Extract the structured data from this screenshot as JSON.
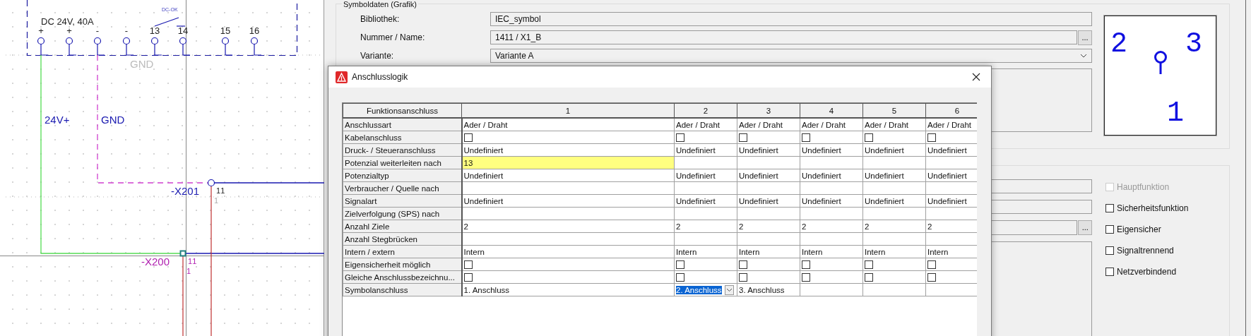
{
  "schematic": {
    "contact_label": "DC-OK",
    "device_rating": "DC 24V, 40A",
    "terminals": [
      "+",
      "+",
      "-",
      "-",
      "13",
      "14",
      "15",
      "16"
    ],
    "net_label": "GND",
    "wires": [
      {
        "label": "24V+"
      },
      {
        "label": "GND"
      }
    ],
    "terminal_strips": [
      {
        "name": "-X201",
        "terminal": "11",
        "pin": "1"
      },
      {
        "name": "-X200",
        "terminal": "11",
        "pin": "1"
      }
    ]
  },
  "properties": {
    "group_title": "Symboldaten (Grafik)",
    "fields": [
      {
        "label": "Bibliothek:",
        "value": "IEC_symbol",
        "kind": "text"
      },
      {
        "label": "Nummer / Name:",
        "value": "1411 / X1_B",
        "kind": "browse",
        "button": "..."
      },
      {
        "label": "Variante:",
        "value": "Variante A",
        "kind": "dropdown"
      }
    ],
    "preview_pins": [
      "2",
      "3",
      "1"
    ],
    "browse_button": "...",
    "options": [
      {
        "label": "Hauptfunktion",
        "checked": false,
        "disabled": true
      },
      {
        "label": "Sicherheitsfunktion",
        "checked": false,
        "disabled": false
      },
      {
        "label": "Eigensicher",
        "checked": false,
        "disabled": false
      },
      {
        "label": "Signaltrennend",
        "checked": false,
        "disabled": false
      },
      {
        "label": "Netzverbindend",
        "checked": false,
        "disabled": false
      }
    ]
  },
  "dialog": {
    "title": "Anschlusslogik",
    "corner_header": "Funktionsanschluss",
    "columns": [
      "1",
      "2",
      "3",
      "4",
      "5",
      "6"
    ],
    "rows": [
      {
        "label": "Anschlussart",
        "kind": "text",
        "cells": [
          {
            "text": "Ader / Draht"
          },
          {
            "text": "Ader / Draht"
          },
          {
            "text": "Ader / Draht"
          },
          {
            "text": "Ader / Draht"
          },
          {
            "text": "Ader / Draht"
          },
          {
            "text": "Ader / Draht"
          }
        ]
      },
      {
        "label": "Kabelanschluss",
        "kind": "checkbox",
        "cells": [
          {
            "checked": false
          },
          {
            "checked": false
          },
          {
            "checked": false
          },
          {
            "checked": false
          },
          {
            "checked": false
          },
          {
            "checked": false
          }
        ]
      },
      {
        "label": "Druck- / Steueranschluss",
        "kind": "text",
        "cells": [
          {
            "text": "Undefiniert"
          },
          {
            "text": "Undefiniert"
          },
          {
            "text": "Undefiniert"
          },
          {
            "text": "Undefiniert"
          },
          {
            "text": "Undefiniert"
          },
          {
            "text": "Undefiniert"
          }
        ]
      },
      {
        "label": "Potenzial weiterleiten nach",
        "kind": "text",
        "cells": [
          {
            "text": "13",
            "highlighted": true
          },
          {
            "highlighted": false
          },
          {
            "highlighted": false
          },
          {
            "highlighted": false
          },
          {
            "highlighted": false
          },
          {
            "highlighted": false
          }
        ]
      },
      {
        "label": "Potenzialtyp",
        "kind": "text",
        "cells": [
          {
            "text": "Undefiniert"
          },
          {
            "text": "Undefiniert"
          },
          {
            "text": "Undefiniert"
          },
          {
            "text": "Undefiniert"
          },
          {
            "text": "Undefiniert"
          },
          {
            "text": "Undefiniert"
          }
        ]
      },
      {
        "label": "Verbraucher / Quelle nach",
        "kind": "text",
        "cells": [
          {},
          {},
          {},
          {},
          {},
          {}
        ]
      },
      {
        "label": "Signalart",
        "kind": "text",
        "cells": [
          {
            "text": "Undefiniert"
          },
          {
            "text": "Undefiniert"
          },
          {
            "text": "Undefiniert"
          },
          {
            "text": "Undefiniert"
          },
          {
            "text": "Undefiniert"
          },
          {
            "text": "Undefiniert"
          }
        ]
      },
      {
        "label": "Zielverfolgung (SPS) nach",
        "kind": "text",
        "cells": [
          {},
          {},
          {},
          {},
          {},
          {}
        ]
      },
      {
        "label": "Anzahl Ziele",
        "kind": "text",
        "cells": [
          {
            "text": "2"
          },
          {
            "text": "2"
          },
          {
            "text": "2"
          },
          {
            "text": "2"
          },
          {
            "text": "2"
          },
          {
            "text": "2"
          }
        ]
      },
      {
        "label": "Anzahl Stegbrücken",
        "kind": "text",
        "cells": [
          {},
          {},
          {},
          {},
          {},
          {}
        ]
      },
      {
        "label": "Intern / extern",
        "kind": "text",
        "cells": [
          {
            "text": "Intern"
          },
          {
            "text": "Intern"
          },
          {
            "text": "Intern"
          },
          {
            "text": "Intern"
          },
          {
            "text": "Intern"
          },
          {
            "text": "Intern"
          }
        ]
      },
      {
        "label": "Eigensicherheit möglich",
        "kind": "checkbox",
        "cells": [
          {
            "checked": false
          },
          {
            "checked": false
          },
          {
            "checked": false
          },
          {
            "checked": false
          },
          {
            "checked": false
          },
          {
            "checked": false
          }
        ]
      },
      {
        "label": "Gleiche Anschlussbezeichnu...",
        "kind": "checkbox",
        "cells": [
          {
            "checked": false
          },
          {
            "checked": false
          },
          {
            "checked": false
          },
          {
            "checked": false
          },
          {
            "checked": false
          },
          {
            "checked": false
          }
        ]
      },
      {
        "label": "Symbolanschluss",
        "kind": "dropdown",
        "cells": [
          {
            "text": "1. Anschluss",
            "selected": false
          },
          {
            "text": "2. Anschluss",
            "selected": true
          },
          {
            "text": "3. Anschluss",
            "selected": false
          },
          {
            "selected": false
          },
          {
            "selected": false
          },
          {
            "selected": false
          }
        ]
      }
    ]
  }
}
